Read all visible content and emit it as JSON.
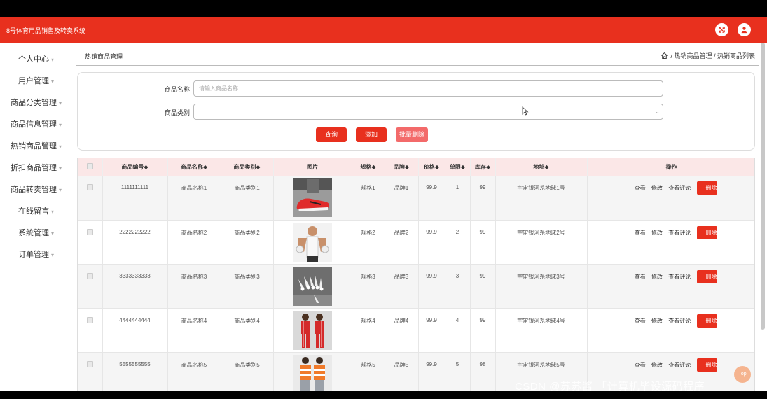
{
  "app": {
    "title": "8号体育用品销售及转卖系统"
  },
  "header_icons": [
    "fullscreen-icon",
    "user-icon"
  ],
  "sidebar": {
    "items": [
      {
        "label": "个人中心"
      },
      {
        "label": "用户管理"
      },
      {
        "label": "商品分类管理"
      },
      {
        "label": "商品信息管理"
      },
      {
        "label": "热销商品管理"
      },
      {
        "label": "折扣商品管理"
      },
      {
        "label": "商品转卖管理"
      },
      {
        "label": "在线留言"
      },
      {
        "label": "系统管理"
      },
      {
        "label": "订单管理"
      }
    ]
  },
  "breadcrumb": {
    "page_title": "热销商品管理",
    "path": "/ 热销商品管理 / 热销商品列表"
  },
  "search": {
    "name_label": "商品名称",
    "name_placeholder": "请输入商品名称",
    "category_label": "商品类别",
    "category_value": "",
    "query_button": "查询",
    "add_button": "添加",
    "batch_delete_button": "批量删除"
  },
  "table": {
    "headers": {
      "code": "商品编号◆",
      "name": "商品名称◆",
      "category": "商品类别◆",
      "image": "图片",
      "spec": "规格◆",
      "brand": "品牌◆",
      "price": "价格◆",
      "limit": "单限◆",
      "stock": "库存◆",
      "address": "地址◆",
      "actions": "操作"
    },
    "action_labels": {
      "view": "查看",
      "edit": "修改",
      "review": "查看评论",
      "delete": "删除"
    },
    "rows": [
      {
        "code": "1111111111",
        "name": "商品名称1",
        "category": "商品类别1",
        "image": "red-sneaker",
        "spec": "规格1",
        "brand": "品牌1",
        "price": "99.9",
        "limit": "1",
        "stock": "99",
        "address": "宇宙银河系地球1号"
      },
      {
        "code": "2222222222",
        "name": "商品名称2",
        "category": "商品类别2",
        "image": "athlete-tanktop",
        "spec": "规格2",
        "brand": "品牌2",
        "price": "99.9",
        "limit": "2",
        "stock": "99",
        "address": "宇宙银河系地球2号"
      },
      {
        "code": "3333333333",
        "name": "商品名称3",
        "category": "商品类别3",
        "image": "shuttlecocks",
        "spec": "规格3",
        "brand": "品牌3",
        "price": "99.9",
        "limit": "3",
        "stock": "99",
        "address": "宇宙银河系地球3号"
      },
      {
        "code": "4444444444",
        "name": "商品名称4",
        "category": "商品类别4",
        "image": "red-tracksuit",
        "spec": "规格4",
        "brand": "品牌4",
        "price": "99.9",
        "limit": "4",
        "stock": "99",
        "address": "宇宙银河系地球4号"
      },
      {
        "code": "5555555555",
        "name": "商品名称5",
        "category": "商品类别5",
        "image": "striped-sportswear",
        "spec": "规格5",
        "brand": "品牌5",
        "price": "99.9",
        "limit": "5",
        "stock": "98",
        "address": "宇宙银河系地球5号"
      }
    ]
  },
  "back_to_top": "Top",
  "watermark": "CSDN @苏苏酱 「计算机毕设源码程序",
  "colors": {
    "primary": "#e8301e",
    "header_row": "#fbe7e7",
    "batch_delete": "#f36a6a"
  }
}
